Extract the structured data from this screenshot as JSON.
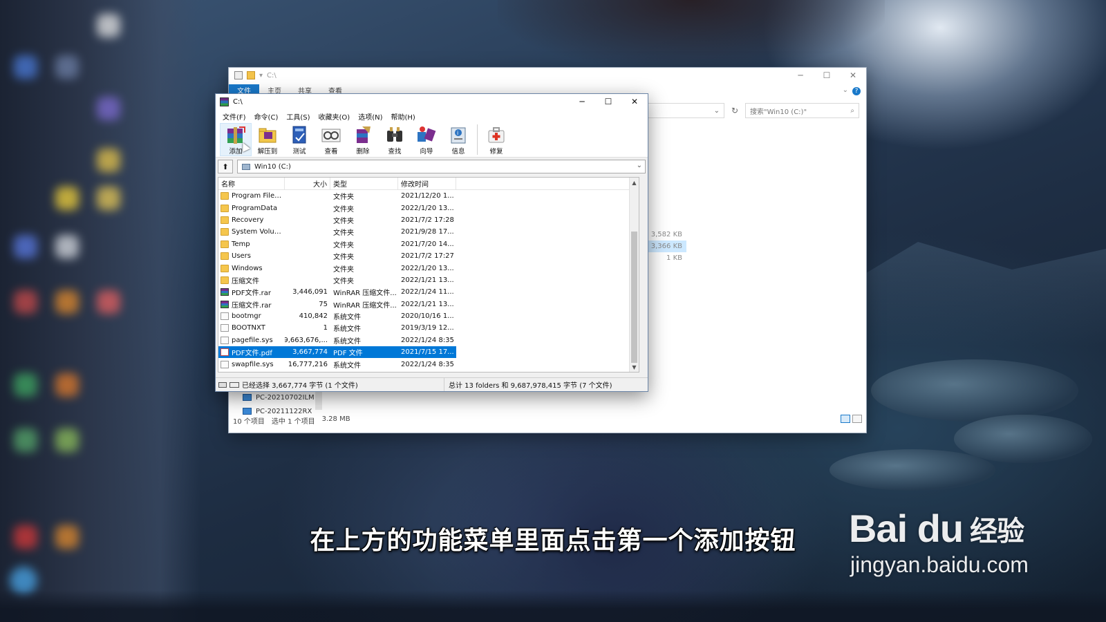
{
  "explorer": {
    "title": "C:\\",
    "ribbon_tabs": [
      "文件",
      "主页",
      "共享",
      "查看"
    ],
    "search_placeholder": "搜索\"Win10 (C:)\"",
    "visible_sizes": [
      "3,582 KB",
      "3,366 KB",
      "1 KB"
    ],
    "nav_items": [
      "PC-20210702ILM",
      "PC-20211122RX"
    ],
    "status": {
      "count": "10 个项目",
      "selected": "选中 1 个项目",
      "size": "3.28 MB"
    }
  },
  "winrar": {
    "title": "C:\\",
    "menu": [
      "文件(F)",
      "命令(C)",
      "工具(S)",
      "收藏夹(O)",
      "选项(N)",
      "帮助(H)"
    ],
    "toolbar": [
      {
        "label": "添加",
        "icon": "add-archive-icon"
      },
      {
        "label": "解压到",
        "icon": "extract-to-icon"
      },
      {
        "label": "测试",
        "icon": "test-icon"
      },
      {
        "label": "查看",
        "icon": "view-icon"
      },
      {
        "label": "删除",
        "icon": "delete-icon"
      },
      {
        "label": "查找",
        "icon": "find-icon"
      },
      {
        "label": "向导",
        "icon": "wizard-icon"
      },
      {
        "label": "信息",
        "icon": "info-icon"
      },
      {
        "label": "修复",
        "icon": "repair-icon"
      }
    ],
    "path": "Win10 (C:)",
    "columns": [
      "名称",
      "大小",
      "类型",
      "修改时间"
    ],
    "files": [
      {
        "name": "Program Files ...",
        "size": "",
        "type": "文件夹",
        "modified": "2021/12/20 1...",
        "kind": "folder"
      },
      {
        "name": "ProgramData",
        "size": "",
        "type": "文件夹",
        "modified": "2022/1/20 13...",
        "kind": "folder"
      },
      {
        "name": "Recovery",
        "size": "",
        "type": "文件夹",
        "modified": "2021/7/2 17:28",
        "kind": "folder"
      },
      {
        "name": "System Volum...",
        "size": "",
        "type": "文件夹",
        "modified": "2021/9/28 17...",
        "kind": "folder"
      },
      {
        "name": "Temp",
        "size": "",
        "type": "文件夹",
        "modified": "2021/7/20 14...",
        "kind": "folder"
      },
      {
        "name": "Users",
        "size": "",
        "type": "文件夹",
        "modified": "2021/7/2 17:27",
        "kind": "folder"
      },
      {
        "name": "Windows",
        "size": "",
        "type": "文件夹",
        "modified": "2022/1/20 13...",
        "kind": "folder"
      },
      {
        "name": "压缩文件",
        "size": "",
        "type": "文件夹",
        "modified": "2022/1/21 13...",
        "kind": "folder"
      },
      {
        "name": "PDF文件.rar",
        "size": "3,446,091",
        "type": "WinRAR 压缩文件...",
        "modified": "2022/1/24 11...",
        "kind": "rar"
      },
      {
        "name": "压缩文件.rar",
        "size": "75",
        "type": "WinRAR 压缩文件...",
        "modified": "2022/1/21 13...",
        "kind": "rar"
      },
      {
        "name": "bootmgr",
        "size": "410,842",
        "type": "系统文件",
        "modified": "2020/10/16 1...",
        "kind": "sys"
      },
      {
        "name": "BOOTNXT",
        "size": "1",
        "type": "系统文件",
        "modified": "2019/3/19 12...",
        "kind": "sys"
      },
      {
        "name": "pagefile.sys",
        "size": "9,663,676,...",
        "type": "系统文件",
        "modified": "2022/1/24 8:35",
        "kind": "sys"
      },
      {
        "name": "PDF文件.pdf",
        "size": "3,667,774",
        "type": "PDF 文件",
        "modified": "2021/7/15 17...",
        "kind": "pdf",
        "selected": true
      },
      {
        "name": "swapfile.sys",
        "size": "16,777,216",
        "type": "系统文件",
        "modified": "2022/1/24 8:35",
        "kind": "sys"
      }
    ],
    "status_left": "已经选择 3,667,774 字节 (1 个文件)",
    "status_right": "总计 13 folders 和 9,687,978,415 字节 (7 个文件)"
  },
  "subtitle": "在上方的功能菜单里面点击第一个添加按钮",
  "watermark": {
    "brand": "Bai du",
    "cn": "经验",
    "url": "jingyan.baidu.com"
  },
  "colors": {
    "selection": "#0078d7",
    "ribbon_active": "#1979ca"
  }
}
